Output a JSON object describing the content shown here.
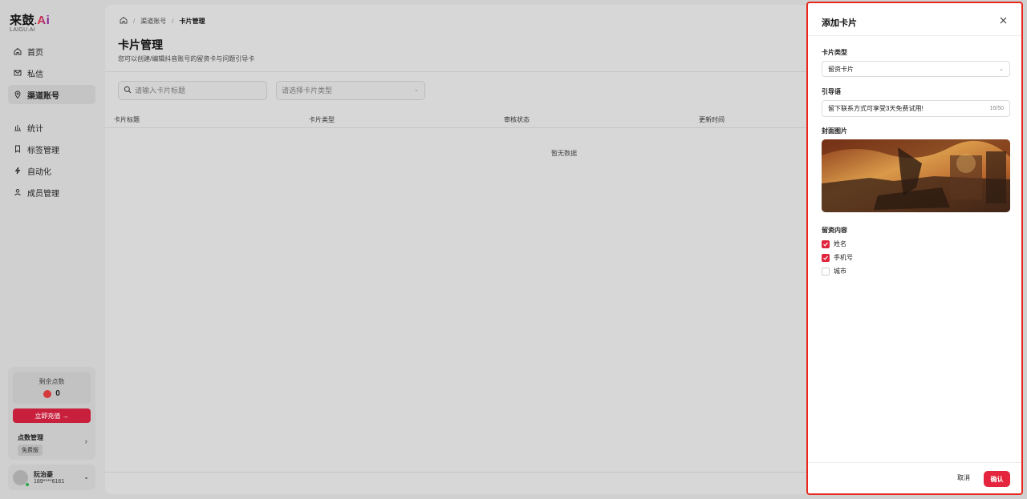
{
  "brand": {
    "logo_text": "来鼓",
    "logo_ai": "Ai",
    "logo_sub": "LAIGU.AI"
  },
  "sidebar": {
    "items": [
      {
        "label": "首页",
        "icon": "home-icon"
      },
      {
        "label": "私信",
        "icon": "mail-icon"
      },
      {
        "label": "渠道账号",
        "icon": "location-icon",
        "active": true
      },
      {
        "label": "统计",
        "icon": "bar-chart-icon"
      },
      {
        "label": "标签管理",
        "icon": "bookmark-icon"
      },
      {
        "label": "自动化",
        "icon": "lightning-icon"
      },
      {
        "label": "成员管理",
        "icon": "user-icon"
      }
    ],
    "points": {
      "label": "剩余点数",
      "value": "0",
      "recharge_label": "立即充值 →",
      "manage_label": "点数管理",
      "plan_badge": "免费版"
    },
    "user": {
      "name": "阮治豪",
      "phone": "189****6161"
    }
  },
  "main": {
    "breadcrumb": [
      "渠道账号",
      "卡片管理"
    ],
    "title": "卡片管理",
    "description": "您可以创建/编辑抖音账号的留资卡与问题引导卡",
    "search_placeholder": "请输入卡片标题",
    "type_placeholder": "请选择卡片类型",
    "table": {
      "columns": [
        "卡片标题",
        "卡片类型",
        "审核状态",
        "更新时间"
      ],
      "empty_text": "暂无数据"
    }
  },
  "drawer": {
    "title": "添加卡片",
    "card_type_label": "卡片类型",
    "card_type_value": "留资卡片",
    "guide_label": "引导语",
    "guide_value": "留下联系方式可享受3天免费试用!",
    "guide_counter": "16/50",
    "cover_label": "封面图片",
    "content_label": "留资内容",
    "options": [
      {
        "label": "姓名",
        "checked": true
      },
      {
        "label": "手机号",
        "checked": true
      },
      {
        "label": "城市",
        "checked": false
      }
    ],
    "cancel_label": "取消",
    "confirm_label": "确认"
  },
  "colors": {
    "accent": "#e4253d",
    "highlight_border": "#e8281c"
  }
}
